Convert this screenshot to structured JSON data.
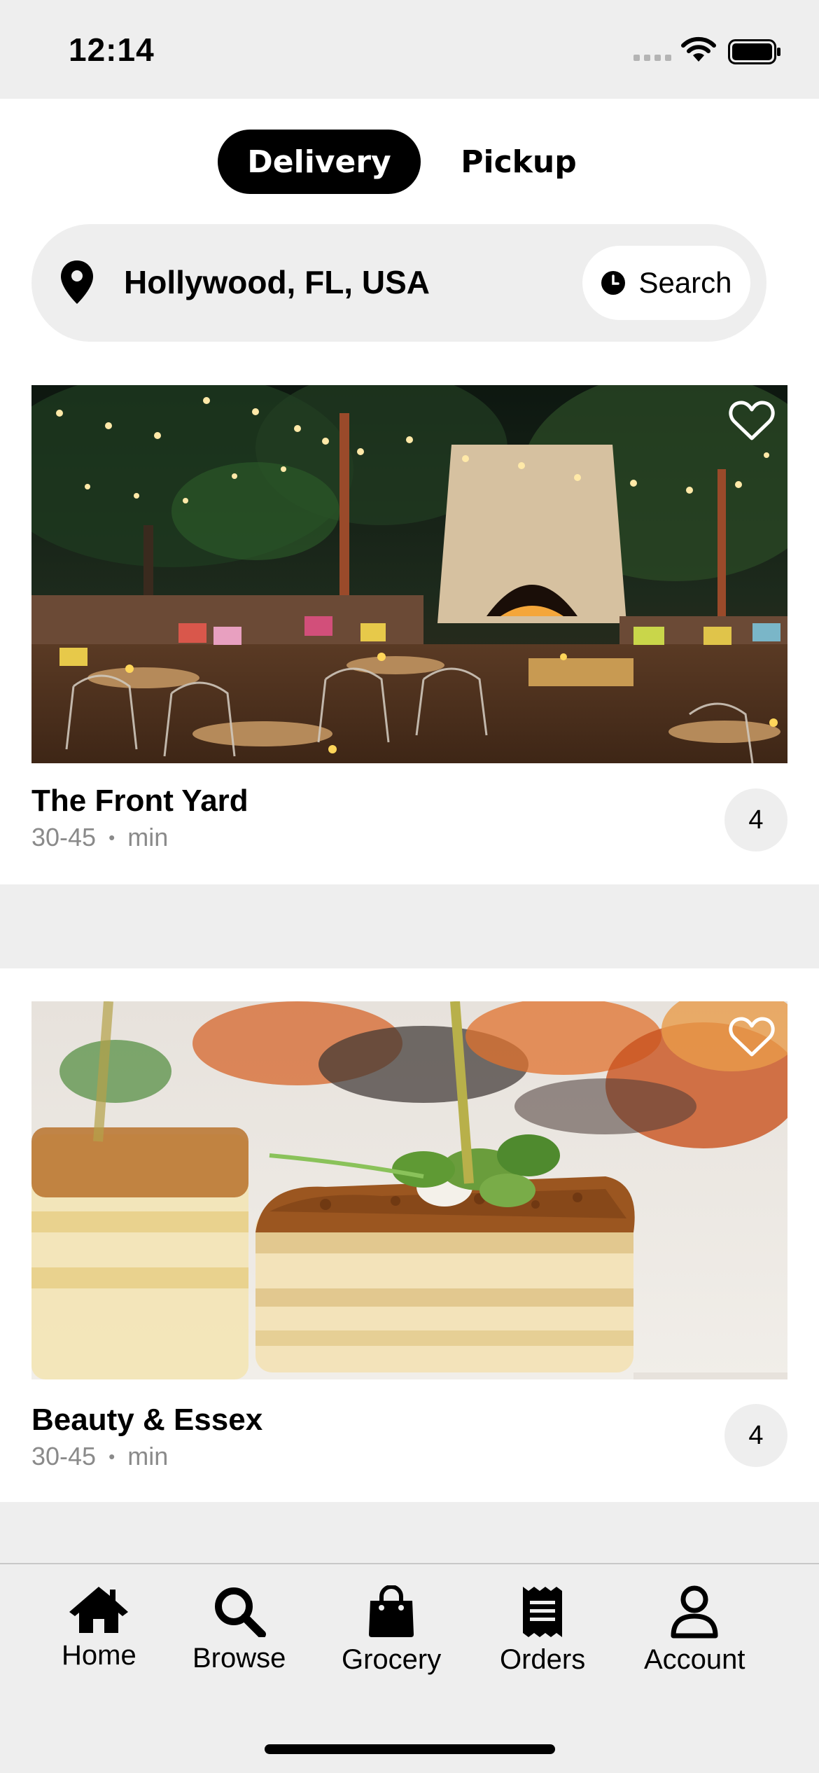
{
  "status_bar": {
    "time": "12:14"
  },
  "mode_toggle": {
    "active_label": "Delivery",
    "inactive_label": "Pickup"
  },
  "location": {
    "text": "Hollywood, FL, USA",
    "search_label": "Search"
  },
  "restaurants": [
    {
      "name": "The Front Yard",
      "eta": "30-45",
      "eta_unit": "min",
      "rating": "4",
      "favorited": false
    },
    {
      "name": "Beauty & Essex",
      "eta": "30-45",
      "eta_unit": "min",
      "rating": "4",
      "favorited": false
    }
  ],
  "meta_separator": "•",
  "tabs": [
    {
      "label": "Home",
      "icon": "home-icon"
    },
    {
      "label": "Browse",
      "icon": "search-icon"
    },
    {
      "label": "Grocery",
      "icon": "shopping-bag-icon"
    },
    {
      "label": "Orders",
      "icon": "receipt-icon"
    },
    {
      "label": "Account",
      "icon": "person-icon"
    }
  ]
}
